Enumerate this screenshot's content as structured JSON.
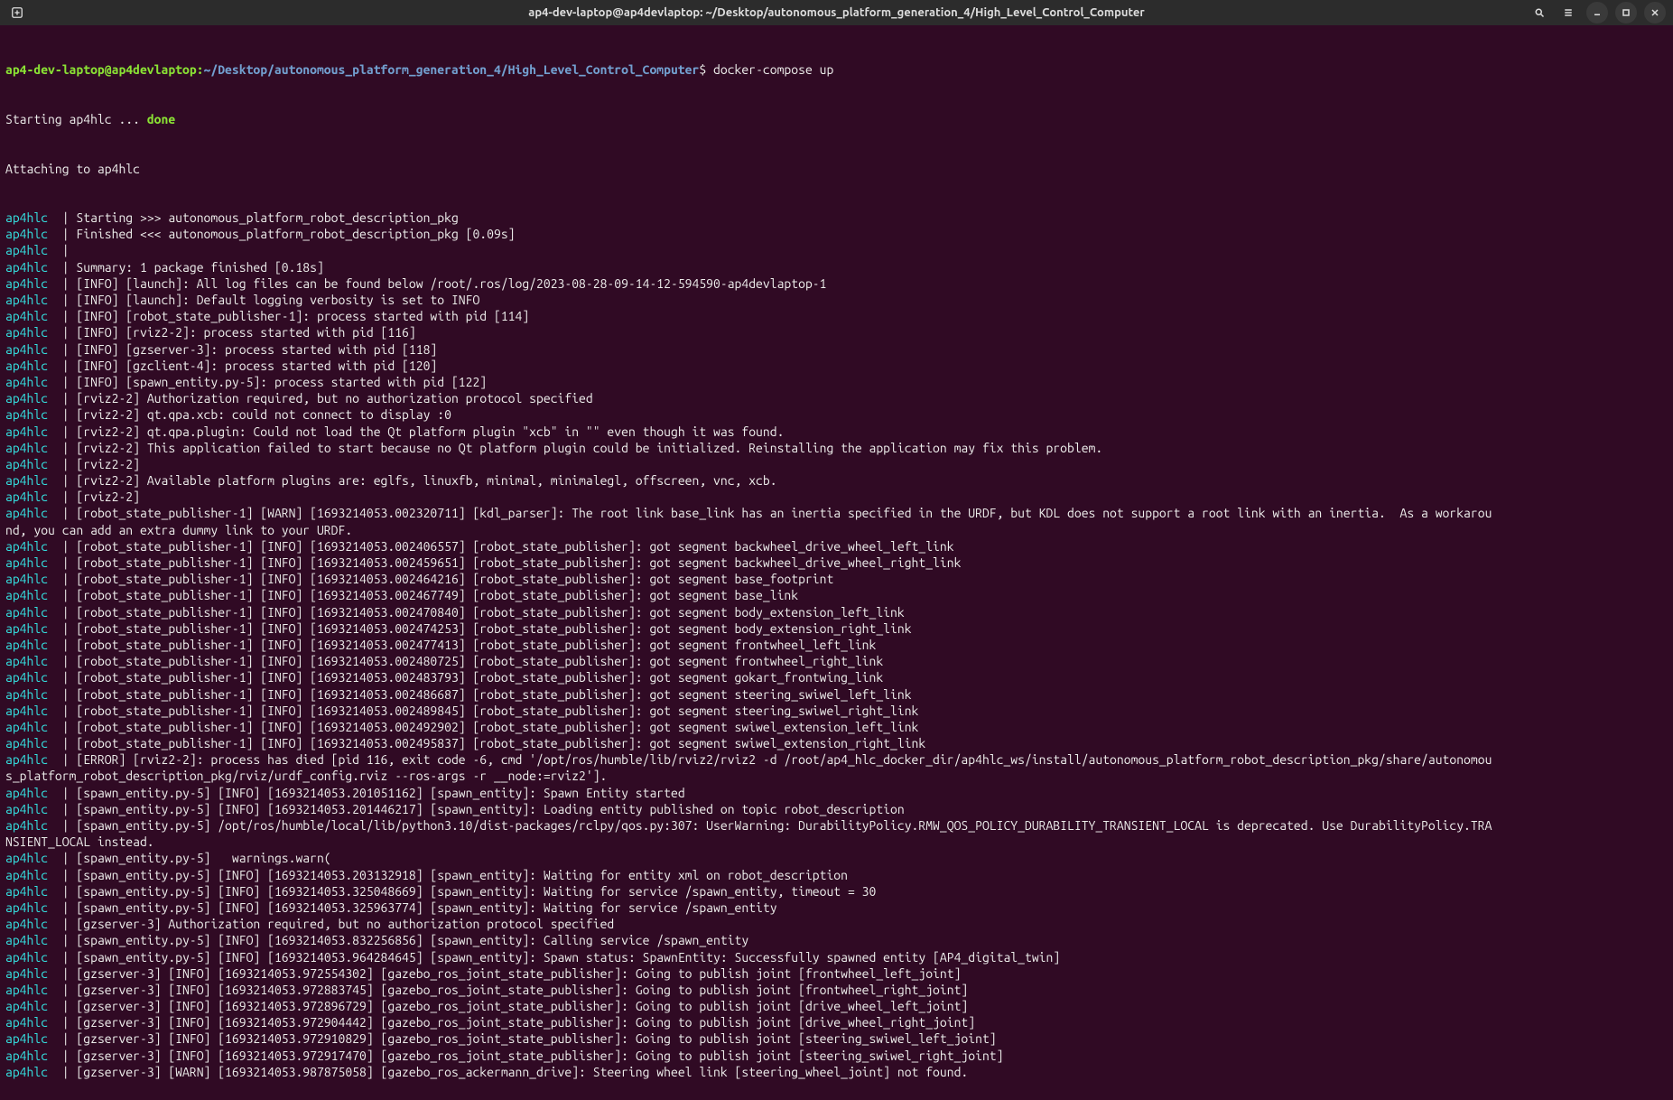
{
  "window": {
    "title": "ap4-dev-laptop@ap4devlaptop: ~/Desktop/autonomous_platform_generation_4/High_Level_Control_Computer"
  },
  "prompt": {
    "user_host": "ap4-dev-laptop@ap4devlaptop:",
    "path": "~/Desktop/autonomous_platform_generation_4/High_Level_Control_Computer",
    "symbol": "$",
    "command": "docker-compose up"
  },
  "prefix_container": "ap4hlc",
  "separator": "  | ",
  "startup": {
    "starting": "Starting ap4hlc ... ",
    "done": "done",
    "attaching": "Attaching to ap4hlc"
  },
  "lines": [
    "Starting >>> autonomous_platform_robot_description_pkg",
    "Finished <<< autonomous_platform_robot_description_pkg [0.09s]",
    "",
    "Summary: 1 package finished [0.18s]",
    "[INFO] [launch]: All log files can be found below /root/.ros/log/2023-08-28-09-14-12-594590-ap4devlaptop-1",
    "[INFO] [launch]: Default logging verbosity is set to INFO",
    "[INFO] [robot_state_publisher-1]: process started with pid [114]",
    "[INFO] [rviz2-2]: process started with pid [116]",
    "[INFO] [gzserver-3]: process started with pid [118]",
    "[INFO] [gzclient-4]: process started with pid [120]",
    "[INFO] [spawn_entity.py-5]: process started with pid [122]",
    "[rviz2-2] Authorization required, but no authorization protocol specified",
    "[rviz2-2] qt.qpa.xcb: could not connect to display :0",
    "[rviz2-2] qt.qpa.plugin: Could not load the Qt platform plugin \"xcb\" in \"\" even though it was found.",
    "[rviz2-2] This application failed to start because no Qt platform plugin could be initialized. Reinstalling the application may fix this problem.",
    "[rviz2-2] ",
    "[rviz2-2] Available platform plugins are: eglfs, linuxfb, minimal, minimalegl, offscreen, vnc, xcb.",
    "[rviz2-2] ",
    "[robot_state_publisher-1] [WARN] [1693214053.002320711] [kdl_parser]: The root link base_link has an inertia specified in the URDF, but KDL does not support a root link with an inertia.  As a workaround, you can add an extra dummy link to your URDF.",
    "[robot_state_publisher-1] [INFO] [1693214053.002406557] [robot_state_publisher]: got segment backwheel_drive_wheel_left_link",
    "[robot_state_publisher-1] [INFO] [1693214053.002459651] [robot_state_publisher]: got segment backwheel_drive_wheel_right_link",
    "[robot_state_publisher-1] [INFO] [1693214053.002464216] [robot_state_publisher]: got segment base_footprint",
    "[robot_state_publisher-1] [INFO] [1693214053.002467749] [robot_state_publisher]: got segment base_link",
    "[robot_state_publisher-1] [INFO] [1693214053.002470840] [robot_state_publisher]: got segment body_extension_left_link",
    "[robot_state_publisher-1] [INFO] [1693214053.002474253] [robot_state_publisher]: got segment body_extension_right_link",
    "[robot_state_publisher-1] [INFO] [1693214053.002477413] [robot_state_publisher]: got segment frontwheel_left_link",
    "[robot_state_publisher-1] [INFO] [1693214053.002480725] [robot_state_publisher]: got segment frontwheel_right_link",
    "[robot_state_publisher-1] [INFO] [1693214053.002483793] [robot_state_publisher]: got segment gokart_frontwing_link",
    "[robot_state_publisher-1] [INFO] [1693214053.002486687] [robot_state_publisher]: got segment steering_swiwel_left_link",
    "[robot_state_publisher-1] [INFO] [1693214053.002489845] [robot_state_publisher]: got segment steering_swiwel_right_link",
    "[robot_state_publisher-1] [INFO] [1693214053.002492902] [robot_state_publisher]: got segment swiwel_extension_left_link",
    "[robot_state_publisher-1] [INFO] [1693214053.002495837] [robot_state_publisher]: got segment swiwel_extension_right_link",
    "[ERROR] [rviz2-2]: process has died [pid 116, exit code -6, cmd '/opt/ros/humble/lib/rviz2/rviz2 -d /root/ap4_hlc_docker_dir/ap4hlc_ws/install/autonomous_platform_robot_description_pkg/share/autonomous_platform_robot_description_pkg/rviz/urdf_config.rviz --ros-args -r __node:=rviz2'].",
    "[spawn_entity.py-5] [INFO] [1693214053.201051162] [spawn_entity]: Spawn Entity started",
    "[spawn_entity.py-5] [INFO] [1693214053.201446217] [spawn_entity]: Loading entity published on topic robot_description",
    "[spawn_entity.py-5] /opt/ros/humble/local/lib/python3.10/dist-packages/rclpy/qos.py:307: UserWarning: DurabilityPolicy.RMW_QOS_POLICY_DURABILITY_TRANSIENT_LOCAL is deprecated. Use DurabilityPolicy.TRANSIENT_LOCAL instead.",
    "[spawn_entity.py-5]   warnings.warn(",
    "[spawn_entity.py-5] [INFO] [1693214053.203132918] [spawn_entity]: Waiting for entity xml on robot_description",
    "[spawn_entity.py-5] [INFO] [1693214053.325048669] [spawn_entity]: Waiting for service /spawn_entity, timeout = 30",
    "[spawn_entity.py-5] [INFO] [1693214053.325963774] [spawn_entity]: Waiting for service /spawn_entity",
    "[gzserver-3] Authorization required, but no authorization protocol specified",
    "[spawn_entity.py-5] [INFO] [1693214053.832256856] [spawn_entity]: Calling service /spawn_entity",
    "[spawn_entity.py-5] [INFO] [1693214053.964284645] [spawn_entity]: Spawn status: SpawnEntity: Successfully spawned entity [AP4_digital_twin]",
    "[gzserver-3] [INFO] [1693214053.972554302] [gazebo_ros_joint_state_publisher]: Going to publish joint [frontwheel_left_joint]",
    "[gzserver-3] [INFO] [1693214053.972883745] [gazebo_ros_joint_state_publisher]: Going to publish joint [frontwheel_right_joint]",
    "[gzserver-3] [INFO] [1693214053.972896729] [gazebo_ros_joint_state_publisher]: Going to publish joint [drive_wheel_left_joint]",
    "[gzserver-3] [INFO] [1693214053.972904442] [gazebo_ros_joint_state_publisher]: Going to publish joint [drive_wheel_right_joint]",
    "[gzserver-3] [INFO] [1693214053.972910829] [gazebo_ros_joint_state_publisher]: Going to publish joint [steering_swiwel_left_joint]",
    "[gzserver-3] [INFO] [1693214053.972917470] [gazebo_ros_joint_state_publisher]: Going to publish joint [steering_swiwel_right_joint]",
    "[gzserver-3] [WARN] [1693214053.987875058] [gazebo_ros_ackermann_drive]: Steering wheel link [steering_wheel_joint] not found."
  ]
}
